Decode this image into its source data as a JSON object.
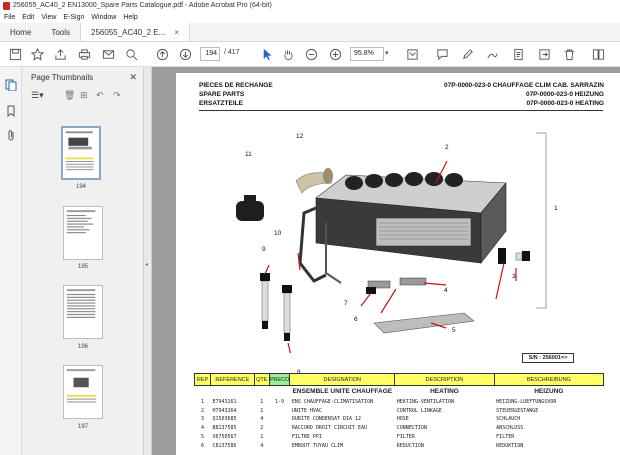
{
  "window": {
    "title": "256055_AC40_2 EN13000_Spare Parts Catalogue.pdf - Adobe Acrobat Pro (64-bit)"
  },
  "menu": [
    "File",
    "Edit",
    "View",
    "E-Sign",
    "Window",
    "Help"
  ],
  "tabs": {
    "home": "Home",
    "tools": "Tools",
    "document": "256055_AC40_2 E...",
    "close": "×"
  },
  "toolbar": {
    "page_current": "194",
    "page_total": "/ 417",
    "zoom": "95.8%"
  },
  "thumbnails": {
    "panel_title": "Page Thumbnails",
    "pages": [
      "194",
      "195",
      "196",
      "197"
    ]
  },
  "document": {
    "header_left": [
      "PIECES DE RECHANGE",
      "SPARE PARTS",
      "ERSATZTEILE"
    ],
    "header_right": [
      "07P-0000-023-0 CHAUFFAGE CLIM CAB. SARRAZIN",
      "07P-0000-023-0 HEIZUNG",
      "07P-0000-023-0 HEATING"
    ],
    "callouts": [
      "1",
      "2",
      "3",
      "4",
      "5",
      "6",
      "7",
      "8",
      "9",
      "10",
      "11",
      "12"
    ],
    "serial": "S/N : 256001=>",
    "table": {
      "headers": [
        "REP",
        "REFERENCE",
        "QTE",
        "PRECO",
        "DESIGNATION",
        "DESCRIPTION",
        "BESCHREIBUNG"
      ],
      "group": {
        "designation": "ENSEMBLE UNITE CHAUFFAGE",
        "description": "HEATING",
        "beschreibung": "HEIZUNG"
      },
      "rows": [
        {
          "rep": "1",
          "ref": "E7943261",
          "qte": "1",
          "preco": "1-9",
          "designation": "ENS CHAUFFAGE-CLIMATISATION",
          "description": "HEATING-VENTILATION",
          "beschreibung": "HEIZUNG-LUEFTUNGSVOR"
        },
        {
          "rep": "2",
          "ref": "H7943264",
          "qte": "1",
          "preco": "",
          "designation": "UNITE HVAC",
          "description": "CONTROL LINKAGE",
          "beschreibung": "STEUERGESTANGE"
        },
        {
          "rep": "3",
          "ref": "Q1503685",
          "qte": "4",
          "preco": "",
          "designation": "DURITE CONDENSAT DIA 12",
          "description": "HOSE",
          "beschreibung": "SCHLAUCH"
        },
        {
          "rep": "4",
          "ref": "B8137585",
          "qte": "2",
          "preco": "",
          "designation": "RACCORD DROIT CIRCUIT EAU",
          "description": "CONNECTION",
          "beschreibung": "ANSCHLUSS"
        },
        {
          "rep": "5",
          "ref": "X6750567",
          "qte": "1",
          "preco": "",
          "designation": "FILTRE PPI",
          "description": "FILTER",
          "beschreibung": "FILTER"
        },
        {
          "rep": "6",
          "ref": "C8137586",
          "qte": "4",
          "preco": "",
          "designation": "EMBOUT TUYAU CLIM",
          "description": "REDUCTION",
          "beschreibung": "REDUKTION"
        }
      ]
    }
  },
  "colors": {
    "table_header": "#ffff66",
    "preco_header": "#99ee99",
    "callout_arrow": "#d01010",
    "pdf_icon": "#d4251d"
  }
}
